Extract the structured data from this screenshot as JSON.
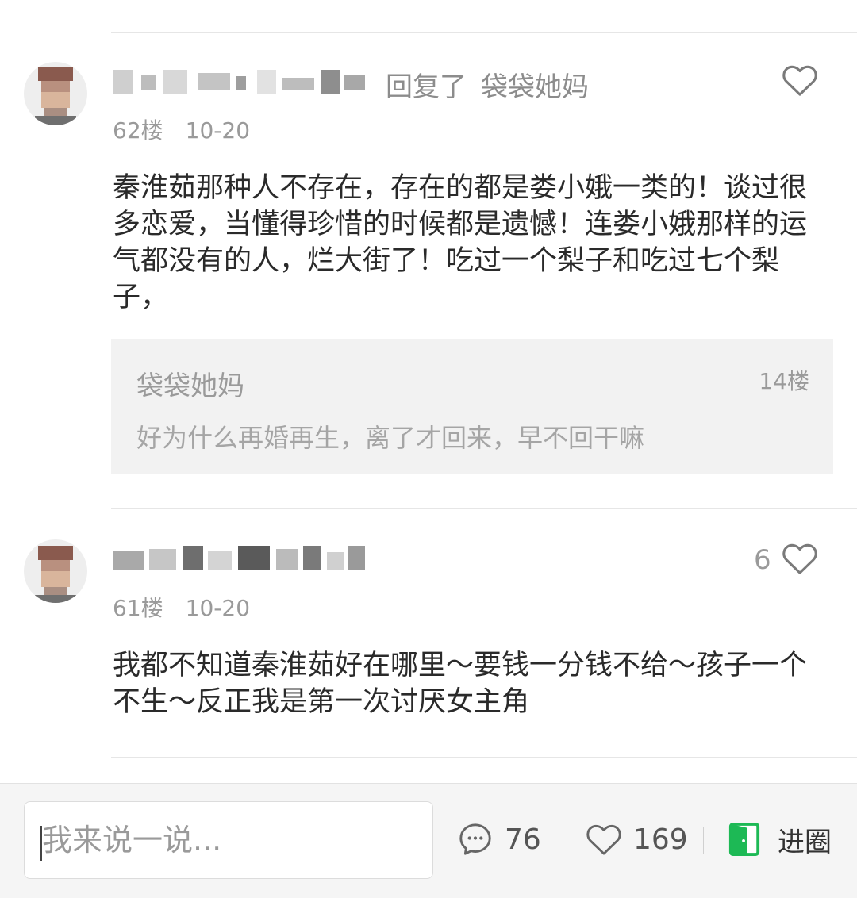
{
  "comments": [
    {
      "reply_verb": "回复了",
      "reply_target": "袋袋她妈",
      "floor": "62楼",
      "date": "10-20",
      "content": "秦淮茹那种人不存在，存在的都是娄小娥一类的！谈过很多恋爱，当懂得珍惜的时候都是遗憾！连娄小娥那样的运气都没有的人，烂大街了！吃过一个梨子和吃过七个梨子，",
      "quote": {
        "author": "袋袋她妈",
        "floor": "14楼",
        "text": "好为什么再婚再生，离了才回来，早不回干嘛"
      }
    },
    {
      "likes": "6",
      "floor": "61楼",
      "date": "10-20",
      "content": "我都不知道秦淮茹好在哪里～要钱一分钱不给～孩子一个不生～反正我是第一次讨厌女主角"
    }
  ],
  "bottom_bar": {
    "input_placeholder": "我来说一说...",
    "comment_count": "76",
    "like_count": "169",
    "enter_circle_label": "进圈"
  },
  "colors": {
    "accent_green": "#1db955",
    "meta_gray": "#9a9a9a"
  },
  "icons": [
    "heart-icon",
    "comment-bubble-icon",
    "door-icon"
  ]
}
